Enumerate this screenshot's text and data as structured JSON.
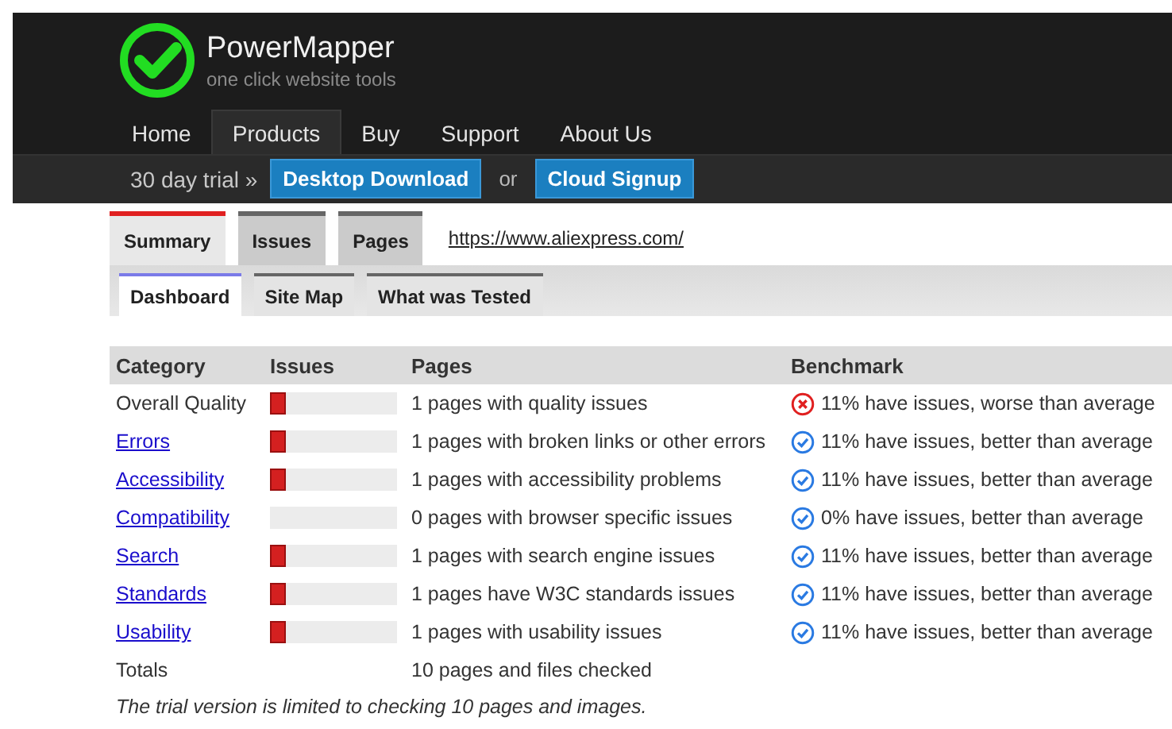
{
  "brand": {
    "name": "PowerMapper",
    "tagline": "one click website tools"
  },
  "nav": [
    {
      "label": "Home",
      "selected": false
    },
    {
      "label": "Products",
      "selected": true
    },
    {
      "label": "Buy",
      "selected": false
    },
    {
      "label": "Support",
      "selected": false
    },
    {
      "label": "About Us",
      "selected": false
    }
  ],
  "trial_bar": {
    "text": "30 day trial »",
    "buttons": [
      "Desktop Download",
      "Cloud Signup"
    ],
    "separator": "or"
  },
  "tabs": [
    {
      "label": "Summary",
      "selected": true
    },
    {
      "label": "Issues",
      "selected": false
    },
    {
      "label": "Pages",
      "selected": false
    }
  ],
  "url": "https://www.aliexpress.com/",
  "subtabs": [
    {
      "label": "Dashboard",
      "selected": true
    },
    {
      "label": "Site Map",
      "selected": false
    },
    {
      "label": "What was Tested",
      "selected": false
    }
  ],
  "table": {
    "columns": [
      "Category",
      "Issues",
      "Pages",
      "Benchmark"
    ],
    "rows": [
      {
        "category": "Overall Quality",
        "kind": "text",
        "level": 0.12,
        "pages": "1 pages with quality issues",
        "worse_than_average": true,
        "benchmark": "11% have issues, worse than average"
      },
      {
        "category": "Errors",
        "kind": "link",
        "level": 0.12,
        "pages": "1 pages with broken links or other errors",
        "worse_than_average": false,
        "benchmark": "11% have issues, better than average"
      },
      {
        "category": "Accessibility",
        "kind": "link",
        "level": 0.12,
        "pages": "1 pages with accessibility problems",
        "worse_than_average": false,
        "benchmark": "11% have issues, better than average"
      },
      {
        "category": "Compatibility",
        "kind": "link",
        "pages": "0 pages with browser specific issues",
        "worse_than_average": false,
        "benchmark": "0% have issues, better than average"
      },
      {
        "category": "Search",
        "kind": "link",
        "level": 0.12,
        "pages": "1 pages with search engine issues",
        "worse_than_average": false,
        "benchmark": "11% have issues, better than average"
      },
      {
        "category": "Standards",
        "kind": "link",
        "level": 0.12,
        "pages": "1 pages have W3C standards issues",
        "worse_than_average": false,
        "benchmark": "11% have issues, better than average"
      },
      {
        "category": "Usability",
        "kind": "link",
        "level": 0.12,
        "pages": "1 pages with usability issues",
        "worse_than_average": false,
        "benchmark": "11% have issues, better than average"
      }
    ],
    "totals": {
      "label": "Totals",
      "pages": "10 pages and files checked"
    }
  },
  "note": "The trial version is limited to checking 10 pages and images."
}
